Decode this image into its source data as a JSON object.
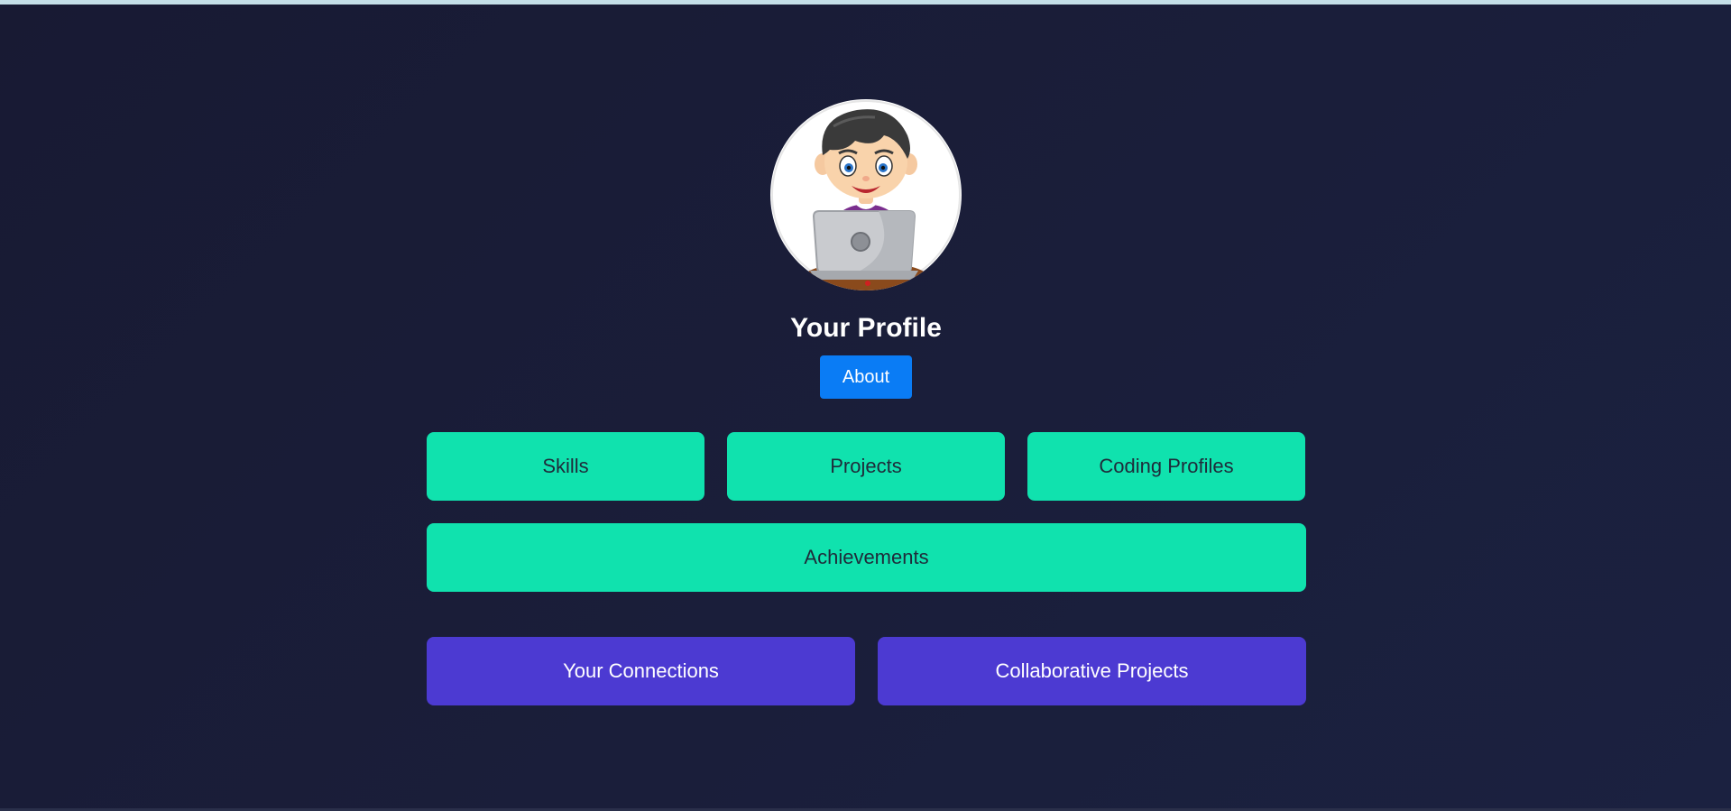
{
  "profile": {
    "avatar_icon": "cartoon-boy-with-laptop",
    "title": "Your Profile",
    "about_label": "About"
  },
  "sections": {
    "skills": "Skills",
    "projects": "Projects",
    "coding_profiles": "Coding Profiles",
    "achievements": "Achievements"
  },
  "social": {
    "connections": "Your Connections",
    "collaborative_projects": "Collaborative Projects"
  },
  "colors": {
    "background": "#1a1e3a",
    "about_button": "#0a7cf5",
    "section_button": "#10e2ae",
    "social_button": "#4c3ad2"
  }
}
